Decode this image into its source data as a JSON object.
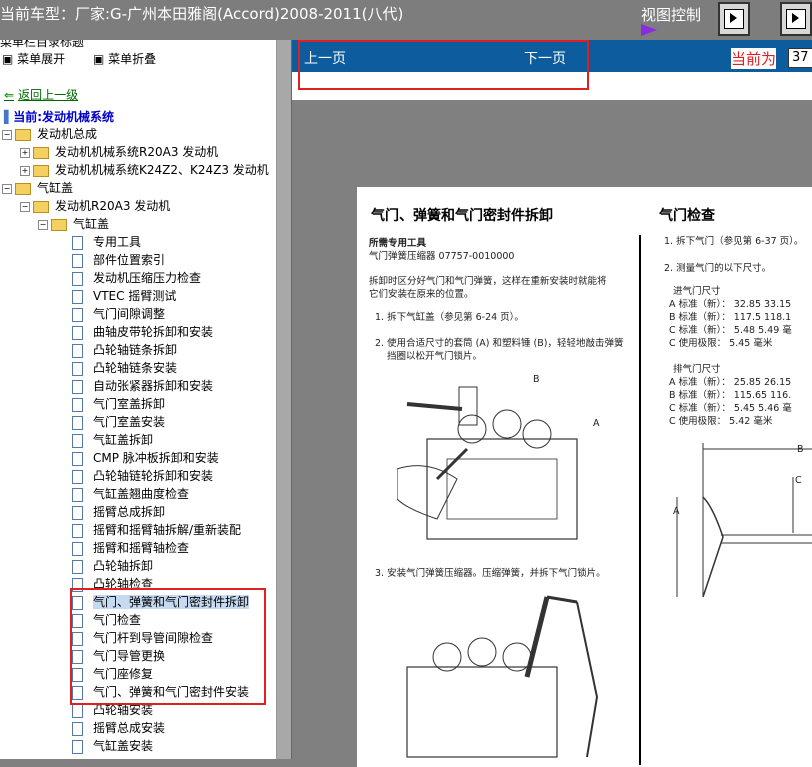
{
  "header": {
    "title": "当前车型：厂家:G-广州本田雅阁(Accord)2008-2011(八代)",
    "view_control": "视图控制"
  },
  "sidebar": {
    "cut_text": "菜单栏目录标题",
    "expand_menu": "菜单展开",
    "collapse_menu": "菜单折叠",
    "back_link": "返回上一级",
    "current": "当前:发动机械系统",
    "tree": [
      {
        "label": "发动机总成",
        "type": "folder",
        "pm": "⊟"
      },
      {
        "label": "发动机机械系统R20A3 发动机",
        "type": "folder",
        "pm": "⊞"
      },
      {
        "label": "发动机机械系统K24Z2、K24Z3 发动机",
        "type": "folder",
        "pm": "⊞"
      },
      {
        "label": "气缸盖",
        "type": "folder",
        "pm": "⊟"
      },
      {
        "label": "发动机R20A3 发动机",
        "type": "folder",
        "pm": "⊟"
      },
      {
        "label": "气缸盖",
        "type": "folder",
        "pm": "⊟"
      }
    ],
    "docs": [
      "专用工具",
      "部件位置索引",
      "发动机压缩压力检查",
      "VTEC 摇臂测试",
      "气门间隙调整",
      "曲轴皮带轮拆卸和安装",
      "凸轮轴链条拆卸",
      "凸轮轴链条安装",
      "自动张紧器拆卸和安装",
      "气门室盖拆卸",
      "气门室盖安装",
      "气缸盖拆卸",
      "CMP 脉冲板拆卸和安装",
      "凸轮轴链轮拆卸和安装",
      "气缸盖翘曲度检查",
      "摇臂总成拆卸",
      "摇臂和摇臂轴拆解/重新装配",
      "摇臂和摇臂轴检查",
      "凸轮轴拆卸",
      "凸轮轴检查",
      "气门、弹簧和气门密封件拆卸",
      "气门检查",
      "气门杆到导管间隙检查",
      "气门导管更换",
      "气门座修复",
      "气门、弹簧和气门密封件安装",
      "凸轮轴安装",
      "摇臂总成安装",
      "气缸盖安装"
    ]
  },
  "content": {
    "prev_page": "上一页",
    "next_page": "下一页",
    "current_page_label": "当前为",
    "current_page_value": "37"
  },
  "document": {
    "left_title": "气门、弹簧和气门密封件拆卸",
    "right_title": "气门检查",
    "tool_heading": "所需专用工具",
    "tool_name": "气门弹簧压缩器 07757-0010000",
    "note_1": "拆卸时区分好气门和气门弹簧，这样在重新安装时就能将",
    "note_2": "它们安装在原来的位置。",
    "step_1": "1. 拆下气缸盖（参见第 6-24 页）。",
    "step_2a": "2. 使用合适尺寸的套筒 (A) 和塑料锤 (B)，轻轻地敲击弹簧",
    "step_2b": "挡圈以松开气门锁片。",
    "step_3": "3. 安装气门弹簧压缩器。压缩弹簧，并拆下气门锁片。",
    "label_a": "A",
    "label_b": "B",
    "r_step_1": "1. 拆下气门（参见第 6-37 页）。",
    "r_step_2": "2. 测量气门的以下尺寸。",
    "intake_title": "进气门尺寸",
    "intake_rows": [
      "A 标准（新）：  32.85  33.15",
      "B 标准（新）：  117.5  118.1",
      "C 标准（新）：  5.48  5.49 毫",
      "C 使用极限：    5.45 毫米"
    ],
    "exhaust_title": "排气门尺寸",
    "exhaust_rows": [
      "A 标准（新）：  25.85  26.15",
      "B 标准（新）：  115.65  116.",
      "C 标准（新）：  5.45  5.46 毫",
      "C 使用极限：    5.42 毫米"
    ],
    "dim_b": "B",
    "dim_c": "C",
    "dim_a": "A"
  }
}
